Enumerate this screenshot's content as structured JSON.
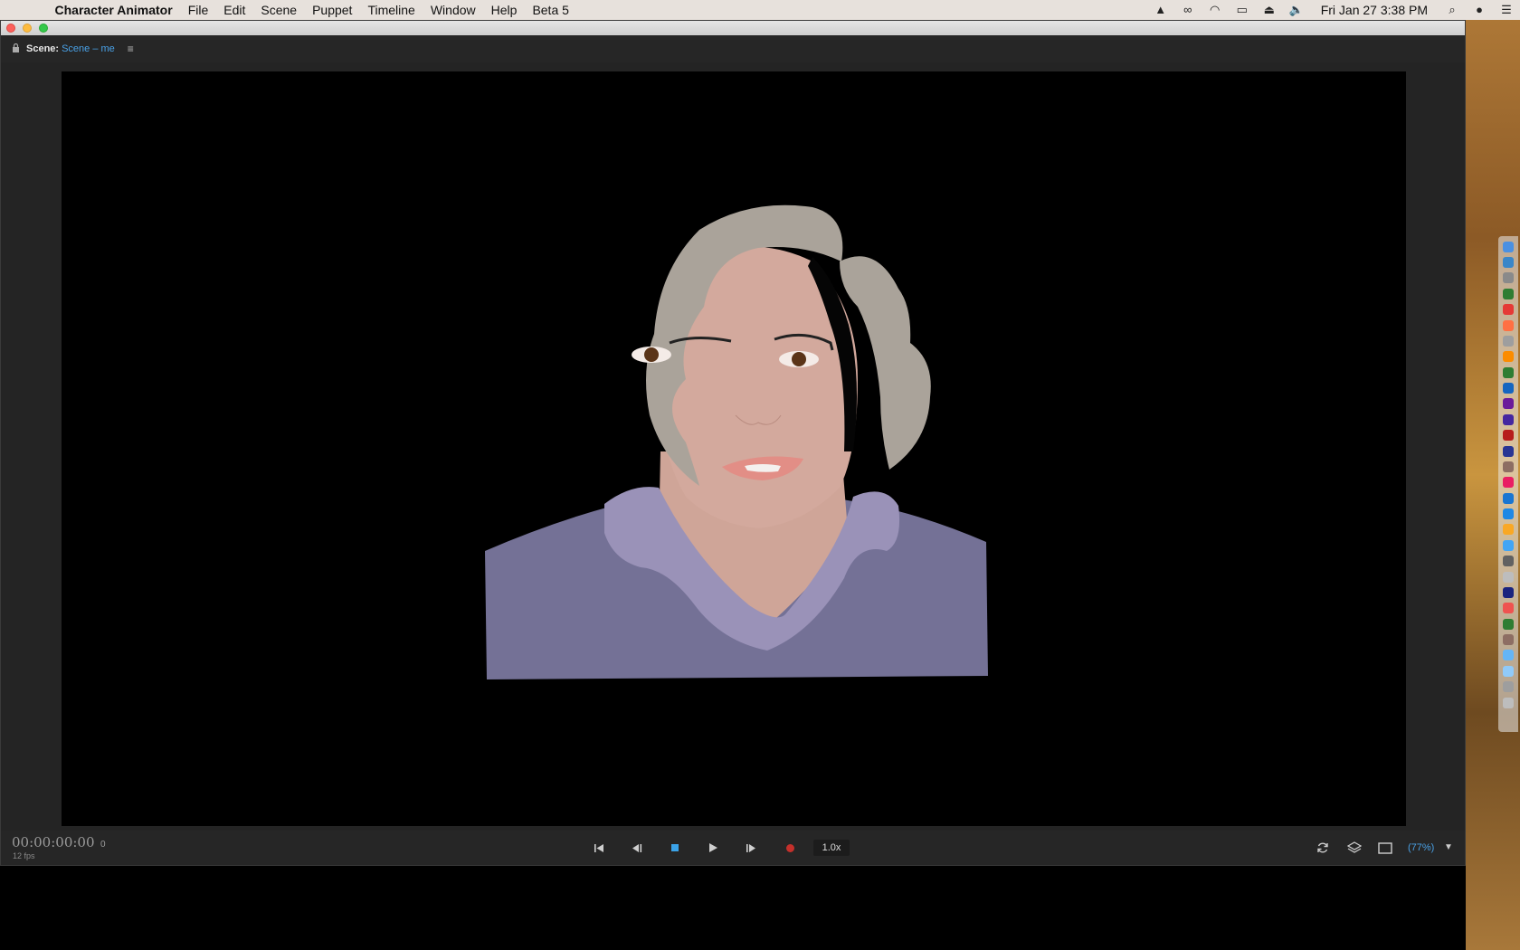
{
  "menubar": {
    "app_name": "Character Animator",
    "items": [
      "File",
      "Edit",
      "Scene",
      "Puppet",
      "Timeline",
      "Window",
      "Help",
      "Beta 5"
    ],
    "status_icons": [
      "google-drive-icon",
      "creative-cloud-icon",
      "wifi-icon",
      "airplay-icon",
      "eject-icon",
      "volume-icon"
    ],
    "clock": "Fri Jan 27  3:38 PM"
  },
  "panel": {
    "label": "Scene:",
    "value": "Scene – me"
  },
  "transport": {
    "timecode": "00:00:00:00",
    "frame": "0",
    "fps": "12 fps",
    "speed": "1.0x",
    "zoom": "(77%)"
  },
  "colors": {
    "accent": "#49a1e6",
    "record": "#c4302b",
    "stop": "#3ba3e8"
  },
  "dock": {
    "icons": [
      "#4a90e2",
      "#3a86c8",
      "#8a8a8a",
      "#2e7d32",
      "#e53935",
      "#ff7043",
      "#9e9e9e",
      "#fb8c00",
      "#2e7d32",
      "#1565c0",
      "#6a1b9a",
      "#4527a0",
      "#b71c1c",
      "#283593",
      "#8d6e63",
      "#e91e63",
      "#1976d2",
      "#1e88e5",
      "#f9a825",
      "#42a5f5",
      "#616161",
      "#bdbdbd",
      "#1a237e",
      "#ef5350",
      "#2e7d32",
      "#8d6e63",
      "#64b5f6",
      "#90caf9",
      "#9e9e9e",
      "#bdbdbd"
    ]
  }
}
